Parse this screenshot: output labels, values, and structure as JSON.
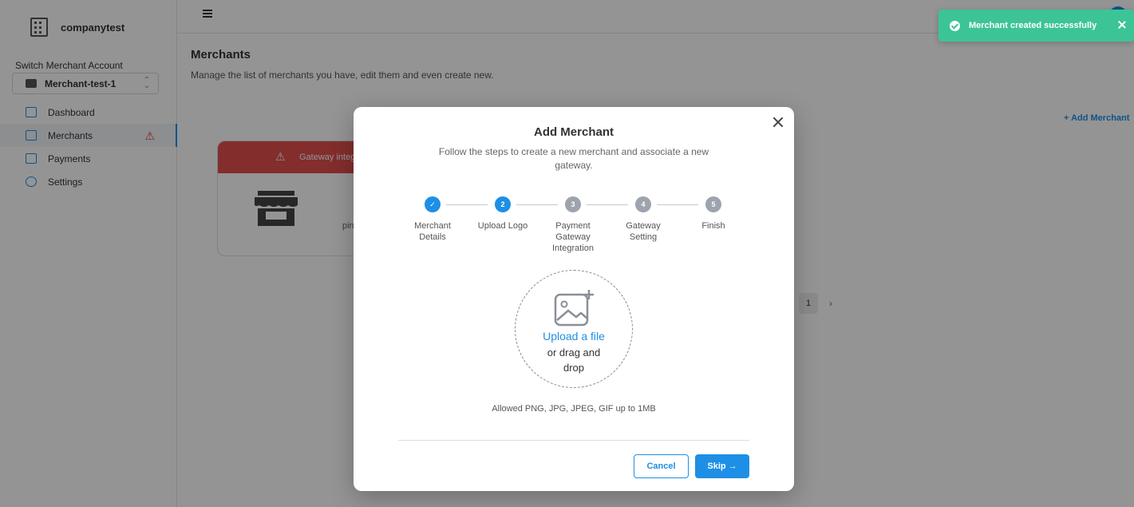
{
  "company": {
    "name": "companytest",
    "icon": "building-icon"
  },
  "switch_account": {
    "label": "Switch Merchant Account",
    "value": "Merchant-test-1"
  },
  "sidebar": {
    "items": [
      {
        "label": "Dashboard",
        "icon": "dashboard-icon"
      },
      {
        "label": "Merchants",
        "icon": "cart-icon",
        "warning": "warning-icon"
      },
      {
        "label": "Payments",
        "icon": "card-icon"
      },
      {
        "label": "Settings",
        "icon": "gear-icon"
      }
    ]
  },
  "page": {
    "title": "Merchants",
    "subtitle": "Manage the list of merchants you have, edit them and even create new.",
    "add_button": "+ Add Merchant",
    "card_banner": "Gateway integ",
    "card_snip": "pin",
    "pagination": {
      "current": "1"
    }
  },
  "modal": {
    "title": "Add Merchant",
    "description": "Follow the steps to create a new merchant and associate a new gateway.",
    "steps": [
      {
        "number": "1",
        "label": "Merchant Details",
        "state": "done"
      },
      {
        "number": "2",
        "label": "Upload Logo",
        "state": "current"
      },
      {
        "number": "3",
        "label": "Payment Gateway Integration",
        "state": "pending"
      },
      {
        "number": "4",
        "label": "Gateway Setting",
        "state": "pending"
      },
      {
        "number": "5",
        "label": "Finish",
        "state": "pending"
      }
    ],
    "upload": {
      "link": "Upload a file",
      "hint": "or drag and drop",
      "allowed": "Allowed PNG, JPG, JPEG, GIF up to 1MB"
    },
    "cancel_label": "Cancel",
    "skip_label": "Skip"
  },
  "toast": {
    "message": "Merchant created successfully"
  },
  "colors": {
    "accent": "#1e8fe6",
    "success": "#3cc497",
    "error": "#e24e4e"
  }
}
